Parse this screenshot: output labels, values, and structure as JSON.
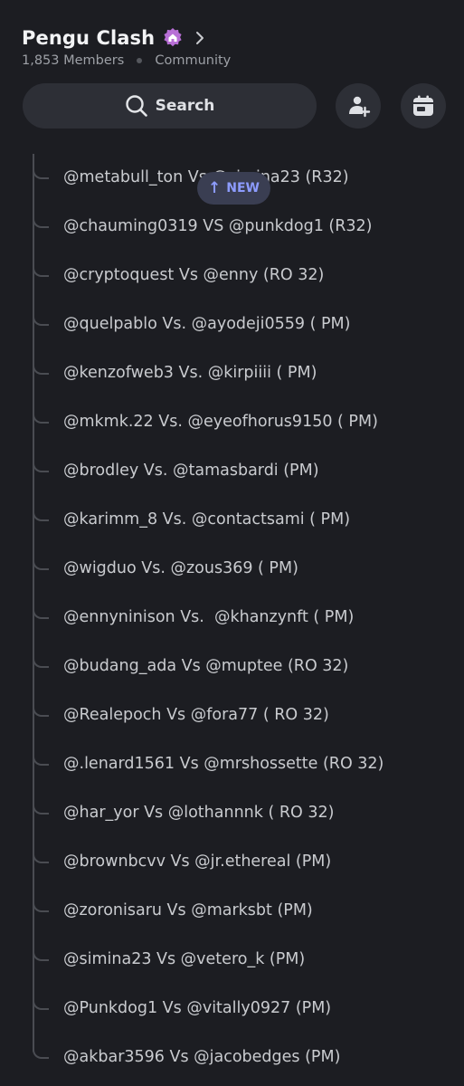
{
  "server": {
    "name": "Pengu Clash",
    "members": "1,853 Members",
    "type": "Community",
    "badge_icon": "home-badge-icon"
  },
  "search": {
    "label": "Search"
  },
  "actions": {
    "invite_icon": "add-member-icon",
    "events_icon": "calendar-icon"
  },
  "new_indicator": {
    "label": "NEW",
    "arrow": "↑"
  },
  "threads": [
    "@metabull_ton Vs @simina23 (R32)",
    "@chauming0319 VS @punkdog1 (R32)",
    "@cryptoquest Vs @enny (RO 32)",
    "@quelpablo Vs. @ayodeji0559 ( PM)",
    "@kenzofweb3 Vs. @kirpiiii ( PM)",
    "@mkmk.22 Vs. @eyeofhorus9150 ( PM)",
    "@brodley Vs. @tamasbardi (PM)",
    "@karimm_8 Vs. @contactsami ( PM)",
    "@wigduo Vs. @zous369 ( PM)",
    "@ennyninison Vs.  @khanzynft ( PM)",
    "@budang_ada Vs @muptee (RO 32)",
    "@Realepoch Vs @fora77 ( RO 32)",
    "@.lenard1561 Vs @mrshossette (RO 32)",
    "@har_yor Vs @lothannnk ( RO 32)",
    "@brownbcvv Vs @jr.ethereal (PM)",
    "@zoronisaru Vs @marksbt (PM)",
    "@simina23 Vs @vetero_k (PM)",
    "@Punkdog1 Vs @vitally0927 (PM)",
    "@akbar3596 Vs @jacobedges (PM)"
  ],
  "colors": {
    "background": "#1c1d22",
    "surface": "#2d2f36",
    "accent_new": "#8d9cff",
    "badge": "#b86fd6"
  }
}
